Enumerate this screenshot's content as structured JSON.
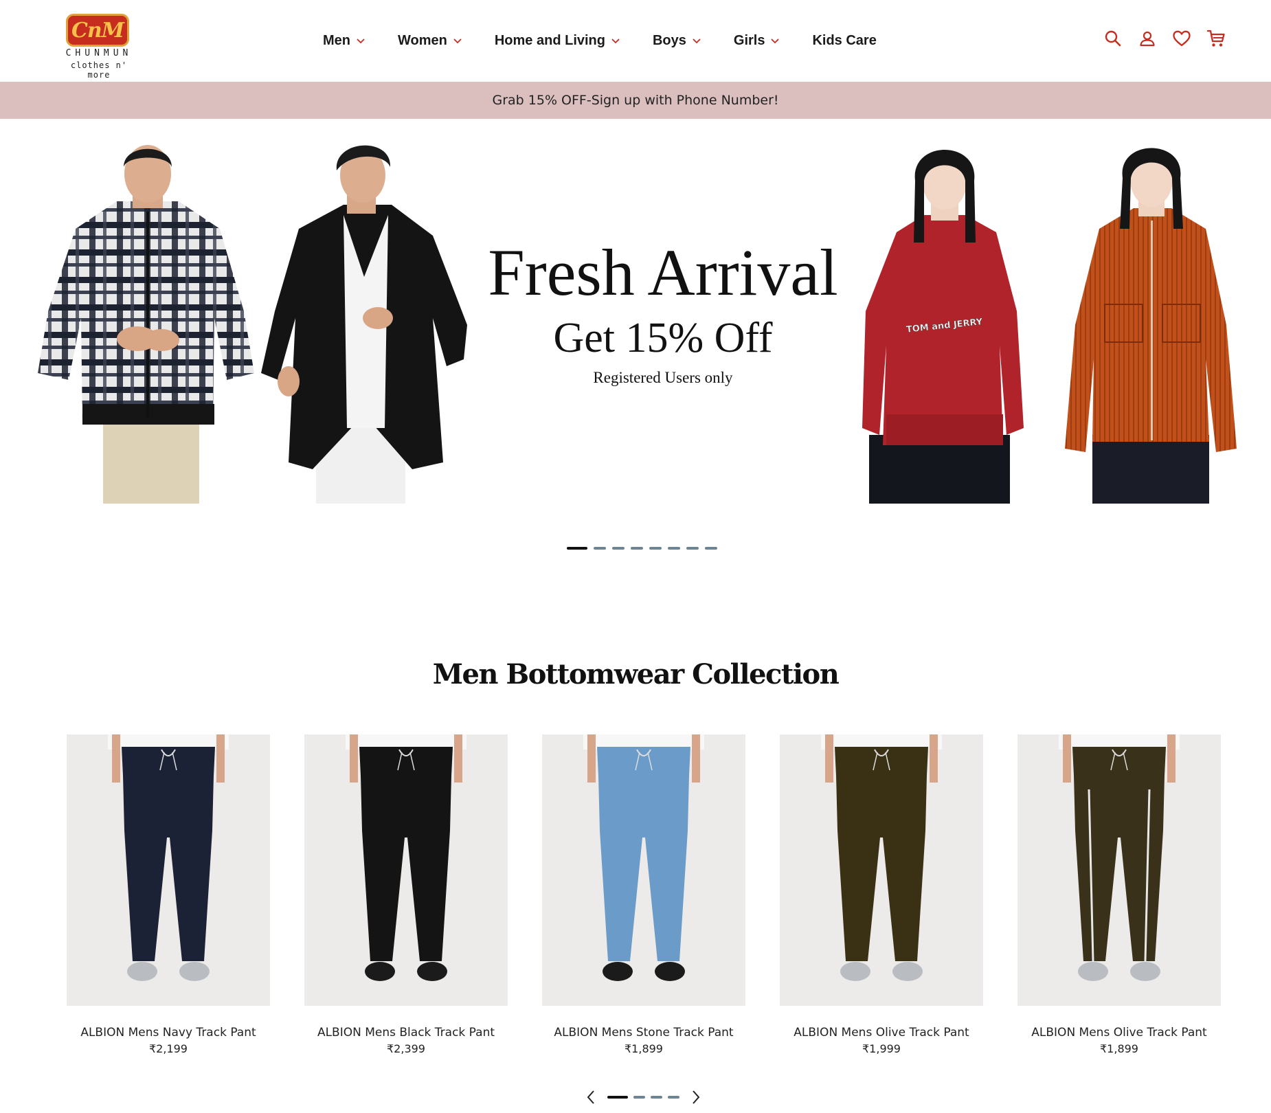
{
  "brand": {
    "logo_mark": "CnM",
    "name": "CHUNMUN",
    "tagline": "clothes n' more",
    "accent_color": "#c62d1f"
  },
  "nav": {
    "items": [
      {
        "label": "Men",
        "has_dropdown": true
      },
      {
        "label": "Women",
        "has_dropdown": true
      },
      {
        "label": "Home and Living",
        "has_dropdown": true
      },
      {
        "label": "Boys",
        "has_dropdown": true
      },
      {
        "label": "Girls",
        "has_dropdown": true
      },
      {
        "label": "Kids Care",
        "has_dropdown": false
      }
    ]
  },
  "header_icons": [
    "search-icon",
    "account-icon",
    "wishlist-heart-icon",
    "cart-icon"
  ],
  "promo_bar": {
    "text": "Grab 15% OFF-Sign up with Phone Number!",
    "background": "#dbbfbf"
  },
  "hero": {
    "title": "Fresh Arrival",
    "subtitle": "Get 15% Off",
    "note": "Registered Users only",
    "slide_count": 8,
    "active_slide": 1,
    "models": [
      {
        "garment": "black and white plaid zip jacket"
      },
      {
        "garment": "black hooded knit cardigan"
      },
      {
        "garment": "red hoodie",
        "print_text": "TOM and JERRY"
      },
      {
        "garment": "rust orange corduroy jacket"
      }
    ]
  },
  "section": {
    "title": "Men Bottomwear Collection"
  },
  "products": [
    {
      "name": "ALBION Mens Navy Track Pant",
      "price": "₹2,199",
      "color": "#1c2236"
    },
    {
      "name": "ALBION Mens Black Track Pant",
      "price": "₹2,399",
      "color": "#141414"
    },
    {
      "name": "ALBION Mens Stone Track Pant",
      "price": "₹1,899",
      "color": "#6b9cc9"
    },
    {
      "name": "ALBION Mens Olive Track Pant",
      "price": "₹1,999",
      "color": "#3a3115"
    },
    {
      "name": "ALBION Mens Olive Track Pant",
      "price": "₹1,899",
      "color": "#39311a"
    }
  ],
  "product_carousel": {
    "page_count": 4,
    "active_page": 1
  }
}
